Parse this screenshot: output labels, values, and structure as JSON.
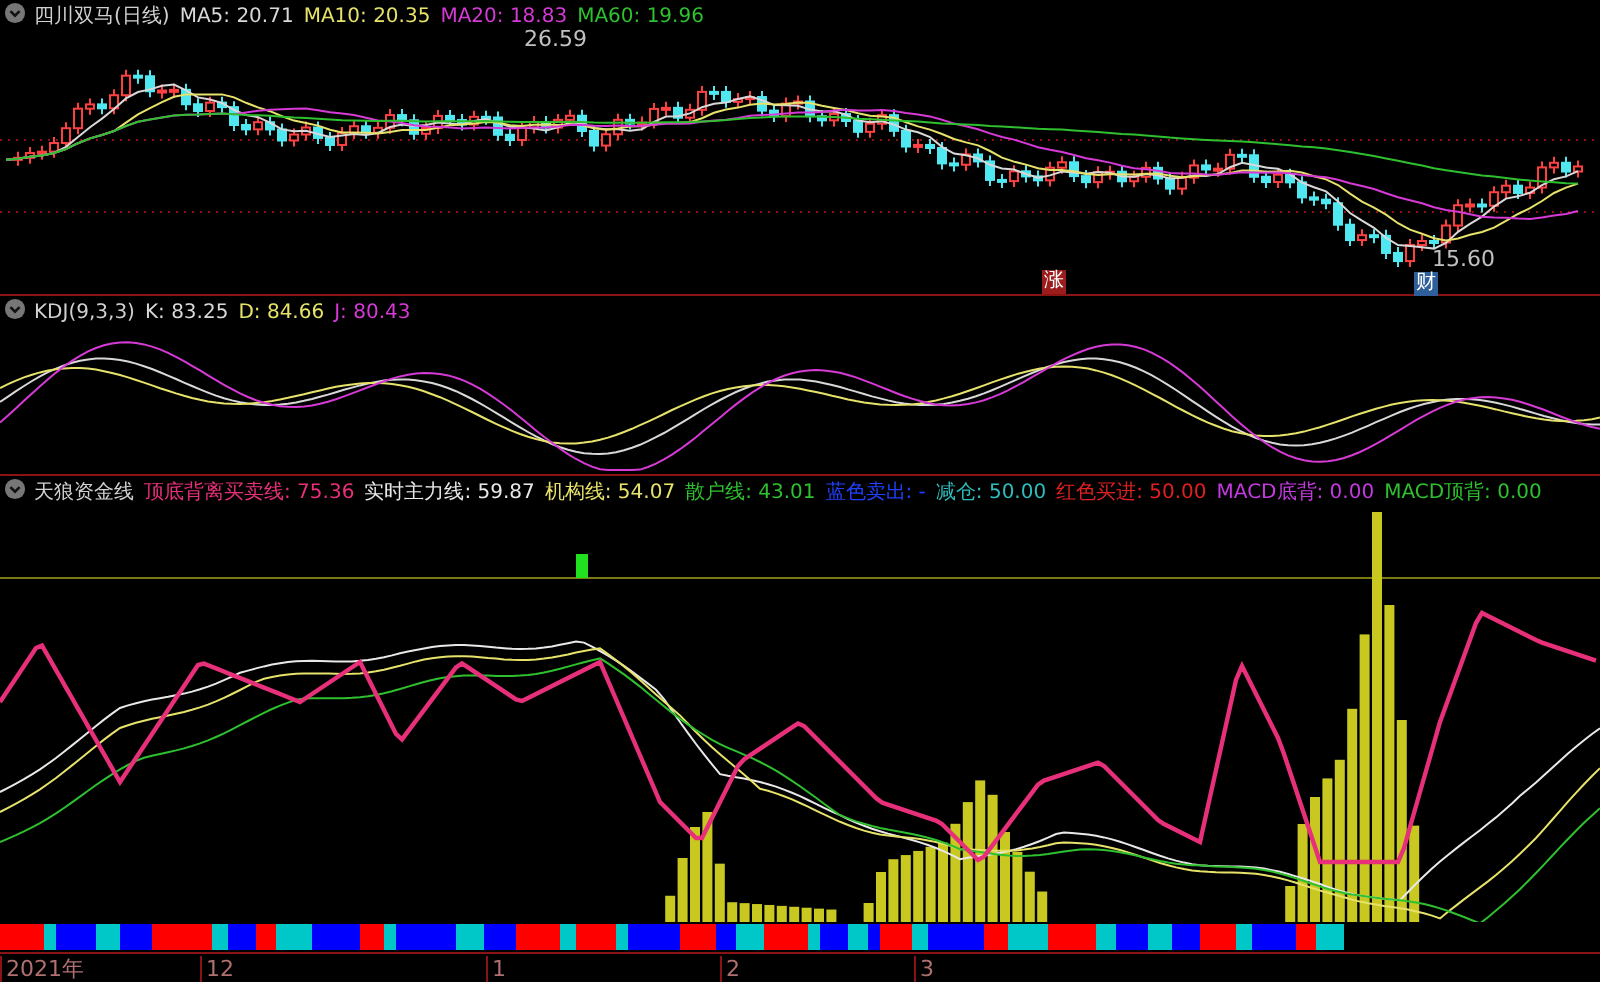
{
  "price_panel": {
    "title": "四川双马(日线)",
    "legend": [
      {
        "label": "MA5: 20.71",
        "color": "#d8d8d8"
      },
      {
        "label": "MA10: 20.35",
        "color": "#e6e26a"
      },
      {
        "label": "MA20: 18.83",
        "color": "#d63ad6"
      },
      {
        "label": "MA60: 19.96",
        "color": "#2ec02e"
      }
    ],
    "high_label": "26.59",
    "low_label": "15.60",
    "markers": [
      {
        "label": "涨",
        "color": "#9a1c1c"
      },
      {
        "label": "财",
        "color": "#2f5f9a"
      }
    ]
  },
  "kdj_panel": {
    "title": "KDJ(9,3,3)",
    "legend": [
      {
        "label": "K: 83.25",
        "color": "#d8d8d8"
      },
      {
        "label": "D: 84.66",
        "color": "#e6e26a"
      },
      {
        "label": "J: 80.43",
        "color": "#d63ad6"
      }
    ]
  },
  "indicator_panel": {
    "title": "天狼资金线",
    "legend": [
      {
        "label": "顶底背离买卖线: 75.36",
        "color": "#e8307a"
      },
      {
        "label": "实时主力线: 59.87",
        "color": "#e8e8e8"
      },
      {
        "label": "机构线: 54.07",
        "color": "#e6e26a"
      },
      {
        "label": "散户线: 43.01",
        "color": "#2ec02e"
      },
      {
        "label": "蓝色卖出: -",
        "color": "#2040ff"
      },
      {
        "label": "减仓: 50.00",
        "color": "#2fbcbc"
      },
      {
        "label": "红色买进: 50.00",
        "color": "#e02020"
      },
      {
        "label": "MACD底背: 0.00",
        "color": "#c43ae0"
      },
      {
        "label": "MACD顶背: 0.00",
        "color": "#2ec02e"
      }
    ]
  },
  "time_axis": [
    "2021年",
    "12",
    "1",
    "2",
    "3"
  ]
}
